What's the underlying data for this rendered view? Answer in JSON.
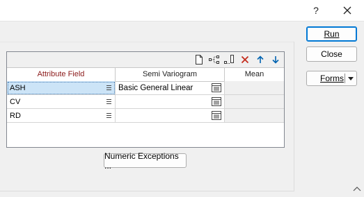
{
  "titlebar": {
    "help_label": "?",
    "close_icon": "close-icon"
  },
  "buttons": {
    "run_label": "Run",
    "close_label": "Close",
    "forms_label": "Forms",
    "numeric_label": "Numeric Exceptions ..."
  },
  "grid": {
    "toolbar_icons": [
      "new-icon",
      "tree-icon",
      "insert-column-icon",
      "delete-icon",
      "move-up-icon",
      "move-down-icon"
    ],
    "headers": {
      "attribute_field": "Attribute Field",
      "semi_variogram": "Semi Variogram",
      "mean": "Mean"
    },
    "rows": [
      {
        "attribute": "ASH",
        "semi_variogram": "Basic General Linear",
        "mean": "",
        "selected": true
      },
      {
        "attribute": "CV",
        "semi_variogram": "",
        "mean": ""
      },
      {
        "attribute": "RD",
        "semi_variogram": "",
        "mean": ""
      }
    ]
  },
  "colors": {
    "header_attribute_text": "#8b1a1a",
    "selected_cell": "#cce4f7",
    "default_button_border": "#0078d4",
    "delete_icon": "#c42b1c",
    "arrow_icon": "#0063b1"
  }
}
